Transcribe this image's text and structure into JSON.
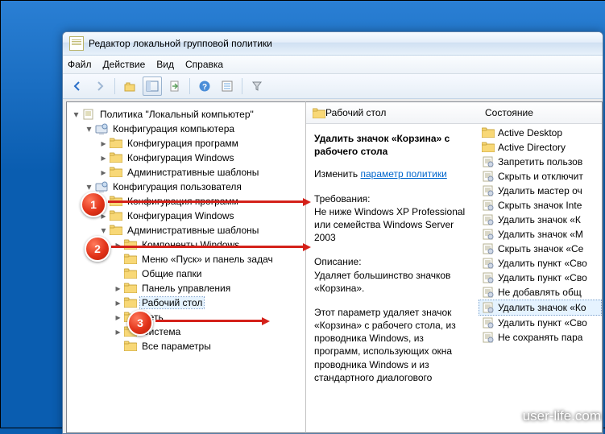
{
  "window": {
    "title": "Редактор локальной групповой политики"
  },
  "menu": {
    "file": "Файл",
    "action": "Действие",
    "view": "Вид",
    "help": "Справка"
  },
  "toolbar_icons": [
    "back-icon",
    "forward-icon",
    "up-icon",
    "show-tree-icon",
    "export-icon",
    "help-icon",
    "properties-icon",
    "filter-icon"
  ],
  "tree": {
    "root": "Политика \"Локальный компьютер\"",
    "items": [
      {
        "lvl": 1,
        "exp": "▾",
        "icon": "cfg",
        "label": "Конфигурация компьютера"
      },
      {
        "lvl": 2,
        "exp": "▸",
        "icon": "fld",
        "label": "Конфигурация программ"
      },
      {
        "lvl": 2,
        "exp": "▸",
        "icon": "fld",
        "label": "Конфигурация Windows"
      },
      {
        "lvl": 2,
        "exp": "▸",
        "icon": "fld",
        "label": "Административные шаблоны"
      },
      {
        "lvl": 1,
        "exp": "▾",
        "icon": "cfg",
        "label": "Конфигурация пользователя",
        "hl": 1
      },
      {
        "lvl": 2,
        "exp": "▸",
        "icon": "fld",
        "label": "Конфигурация программ"
      },
      {
        "lvl": 2,
        "exp": "▸",
        "icon": "fld",
        "label": "Конфигурация Windows"
      },
      {
        "lvl": 2,
        "exp": "▾",
        "icon": "fld",
        "label": "Административные шаблоны",
        "hl": 2
      },
      {
        "lvl": 3,
        "exp": "▸",
        "icon": "fld",
        "label": "Компоненты Windows"
      },
      {
        "lvl": 3,
        "exp": "",
        "icon": "fld",
        "label": "Меню «Пуск» и панель задач"
      },
      {
        "lvl": 3,
        "exp": "",
        "icon": "fld",
        "label": "Общие папки"
      },
      {
        "lvl": 3,
        "exp": "▸",
        "icon": "fld",
        "label": "Панель управления"
      },
      {
        "lvl": 3,
        "exp": "▸",
        "icon": "fld",
        "label": "Рабочий стол",
        "hl": 3,
        "sel": true
      },
      {
        "lvl": 3,
        "exp": "▸",
        "icon": "fld",
        "label": "Сеть"
      },
      {
        "lvl": 3,
        "exp": "▸",
        "icon": "fld",
        "label": "Система"
      },
      {
        "lvl": 3,
        "exp": "",
        "icon": "fld",
        "label": "Все параметры"
      }
    ]
  },
  "detail": {
    "heading": "Рабочий стол",
    "setting_title": "Удалить значок «Корзина» с рабочего стола",
    "edit_prefix": "Изменить ",
    "edit_link": "параметр политики",
    "req_label": "Требования:",
    "req_text": "Не ниже Windows XP Professional или семейства Windows Server 2003",
    "desc_label": "Описание:",
    "desc_text": "Удаляет большинство значков «Корзина».",
    "para": "Этот параметр удаляет значок «Корзина» с рабочего стола, из проводника Windows, из программ, использующих окна проводника Windows и из стандартного диалогового"
  },
  "state": {
    "header": "Состояние",
    "items": [
      {
        "icon": "fld",
        "label": "Active Desktop"
      },
      {
        "icon": "fld",
        "label": "Active Directory"
      },
      {
        "icon": "pol",
        "label": "Запретить пользов"
      },
      {
        "icon": "pol",
        "label": "Скрыть и отключит"
      },
      {
        "icon": "pol",
        "label": "Удалить мастер оч"
      },
      {
        "icon": "pol",
        "label": "Скрыть значок Inte"
      },
      {
        "icon": "pol",
        "label": "Удалить значок «К"
      },
      {
        "icon": "pol",
        "label": "Удалить значок «М"
      },
      {
        "icon": "pol",
        "label": "Скрыть значок «Се"
      },
      {
        "icon": "pol",
        "label": "Удалить пункт «Сво"
      },
      {
        "icon": "pol",
        "label": "Удалить пункт «Сво"
      },
      {
        "icon": "pol",
        "label": "Не добавлять общ"
      },
      {
        "icon": "pol",
        "label": "Удалить значок «Ко",
        "sel": true
      },
      {
        "icon": "pol",
        "label": "Удалить пункт «Сво"
      },
      {
        "icon": "pol",
        "label": "Не сохранять пара"
      }
    ]
  },
  "badges": [
    "1",
    "2",
    "3"
  ],
  "watermark": "user-life.com"
}
